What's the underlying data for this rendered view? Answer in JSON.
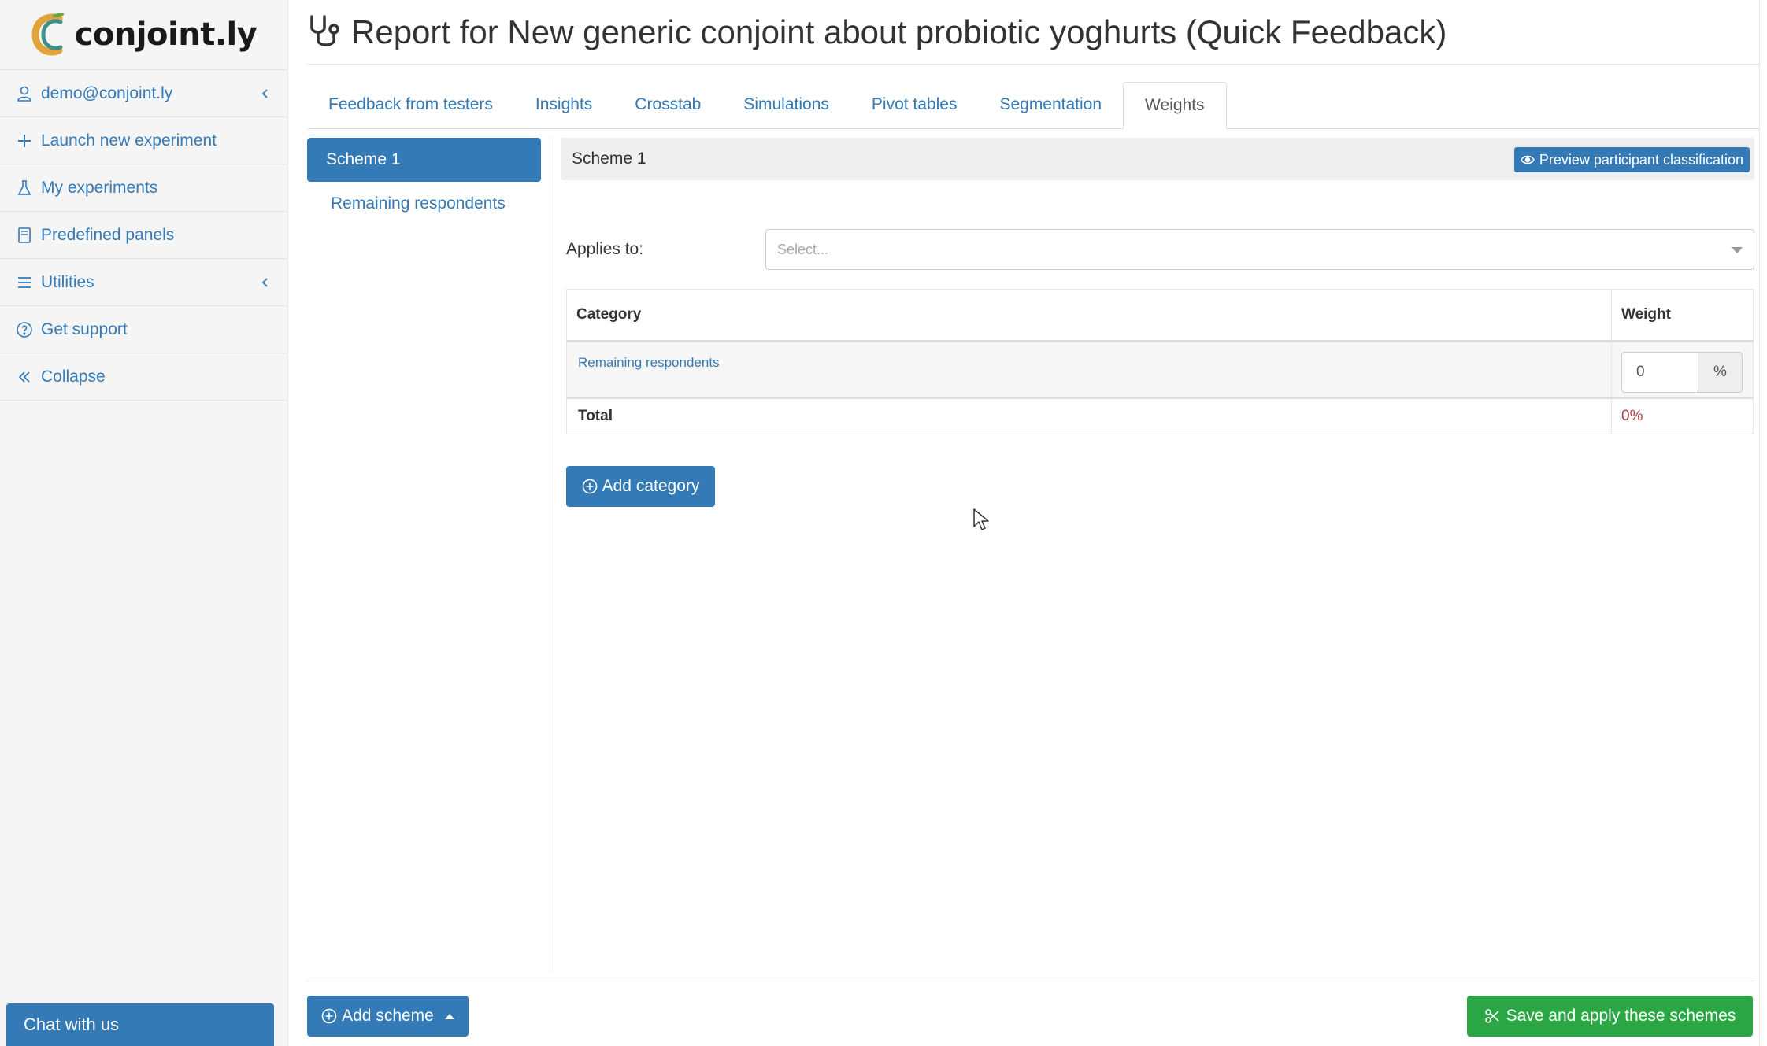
{
  "brand": {
    "name": "conjoint.ly"
  },
  "sidebar": {
    "items": [
      {
        "label": "demo@conjoint.ly",
        "icon": "user-icon",
        "expandable": true
      },
      {
        "label": "Launch new experiment",
        "icon": "plus-icon",
        "expandable": false
      },
      {
        "label": "My experiments",
        "icon": "flask-icon",
        "expandable": false
      },
      {
        "label": "Predefined panels",
        "icon": "book-icon",
        "expandable": false
      },
      {
        "label": "Utilities",
        "icon": "menu-icon",
        "expandable": true
      },
      {
        "label": "Get support",
        "icon": "question-icon",
        "expandable": false
      },
      {
        "label": "Collapse",
        "icon": "double-chevron-left-icon",
        "expandable": false
      }
    ],
    "chat_label": "Chat with us"
  },
  "header": {
    "title": "Report for New generic conjoint about probiotic yoghurts (Quick Feedback)",
    "icon": "stethoscope-icon"
  },
  "tabs": [
    {
      "label": "Feedback from testers",
      "active": false
    },
    {
      "label": "Insights",
      "active": false
    },
    {
      "label": "Crosstab",
      "active": false
    },
    {
      "label": "Simulations",
      "active": false
    },
    {
      "label": "Pivot tables",
      "active": false
    },
    {
      "label": "Segmentation",
      "active": false
    },
    {
      "label": "Weights",
      "active": true
    }
  ],
  "schemes": {
    "items": [
      {
        "label": "Scheme 1",
        "active": true
      },
      {
        "label": "Remaining respondents",
        "active": false
      }
    ]
  },
  "panel": {
    "title": "Scheme 1",
    "preview_label": "Preview participant classification",
    "applies_label": "Applies to:",
    "applies_placeholder": "Select...",
    "table": {
      "headers": {
        "category": "Category",
        "weight": "Weight"
      },
      "rows": [
        {
          "category": "Remaining respondents",
          "weight": "0",
          "unit": "%"
        }
      ],
      "total_label": "Total",
      "total_value": "0%"
    },
    "add_category_label": "Add category"
  },
  "footer": {
    "add_scheme_label": "Add scheme",
    "save_label": "Save and apply these schemes"
  },
  "colors": {
    "primary": "#337ab7",
    "success": "#2aa744",
    "danger_text": "#a94442",
    "sidebar_bg": "#f5f5f5"
  }
}
